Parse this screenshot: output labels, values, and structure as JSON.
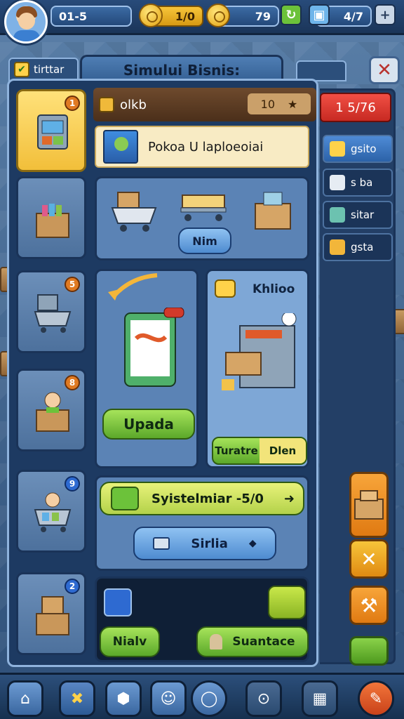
{
  "topbar": {
    "level": "01-5",
    "coins": "1/0",
    "gears": "79",
    "boxes": "4/7",
    "add_symbol": "+"
  },
  "header": {
    "tab_left_label": "tirttar",
    "title": "Simului Bisnis:",
    "close_symbol": "✕"
  },
  "store": {
    "name": "olkb",
    "count": "10",
    "star": "★",
    "player_name": "Pokoa U laploeoiai"
  },
  "panels": {
    "cart_button": "Nim",
    "upgrade_button": "Upada",
    "machine_title": "Khlioo",
    "machine_button_left": "Turatre",
    "machine_button_right": "Dlen",
    "system_label": "Syistelmiar -5/0",
    "small_button": "Sirlia",
    "bottom_left_button": "Nialv",
    "bottom_right_button": "Suantace"
  },
  "right_column": {
    "price": "1 5/76",
    "menu": [
      {
        "label": "gsito",
        "icon": "tag-icon"
      },
      {
        "label": "s ba",
        "icon": "document-icon"
      },
      {
        "label": "sitar",
        "icon": "lightbulb-icon"
      },
      {
        "label": "gsta",
        "icon": "folder-icon"
      }
    ]
  },
  "sidebar": {
    "badges": [
      "1",
      "",
      "5",
      "8",
      "9",
      "2"
    ]
  },
  "colors": {
    "accent_yellow": "#ffd24a",
    "button_green": "#5ba82a",
    "price_red": "#c72a22",
    "frame_blue": "#1d3a62"
  }
}
